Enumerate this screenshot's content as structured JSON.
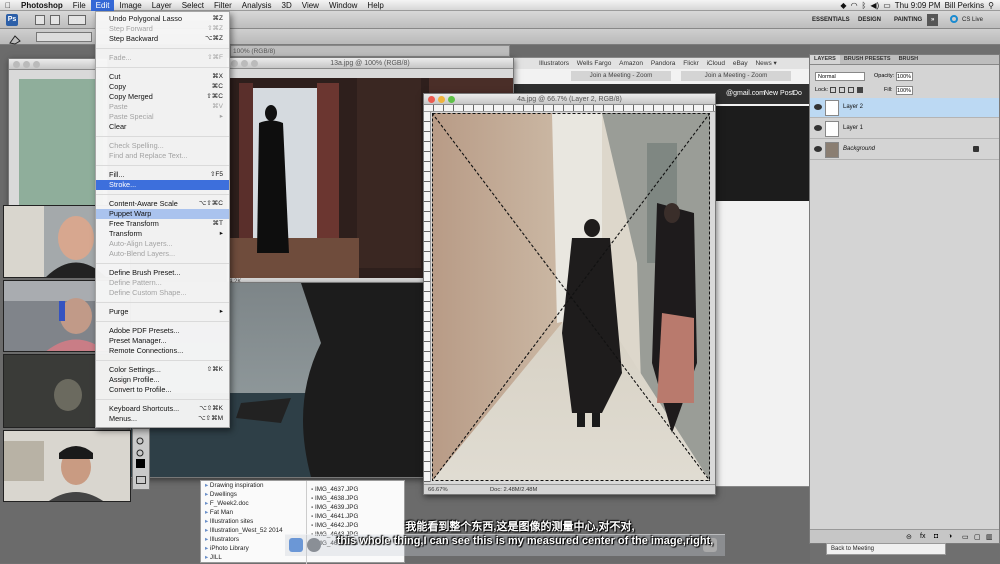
{
  "menubar": {
    "apple": "",
    "app": "Photoshop",
    "items": [
      "File",
      "Edit",
      "Image",
      "Layer",
      "Select",
      "Filter",
      "Analysis",
      "3D",
      "View",
      "Window",
      "Help"
    ],
    "clock": "Thu 9:09 PM",
    "user": "Bill Perkins"
  },
  "appbar": {
    "workspaces": [
      "ESSENTIALS",
      "DESIGN",
      "PAINTING"
    ],
    "more": "»",
    "cslive": "CS Live"
  },
  "edit_menu": {
    "items": [
      {
        "label": "Undo Polygonal Lasso",
        "shortcut": "⌘Z",
        "state": "normal"
      },
      {
        "label": "Step Forward",
        "shortcut": "⇧⌘Z",
        "state": "disabled"
      },
      {
        "label": "Step Backward",
        "shortcut": "⌥⌘Z",
        "state": "normal"
      },
      {
        "label": "Fade...",
        "shortcut": "⇧⌘F",
        "state": "disabled"
      },
      {
        "label": "Cut",
        "shortcut": "⌘X",
        "state": "normal"
      },
      {
        "label": "Copy",
        "shortcut": "⌘C",
        "state": "normal"
      },
      {
        "label": "Copy Merged",
        "shortcut": "⇧⌘C",
        "state": "normal"
      },
      {
        "label": "Paste",
        "shortcut": "⌘V",
        "state": "disabled"
      },
      {
        "label": "Paste Special",
        "shortcut": "▸",
        "state": "disabled"
      },
      {
        "label": "Clear",
        "shortcut": "",
        "state": "normal"
      },
      {
        "label": "Check Spelling...",
        "shortcut": "",
        "state": "disabled"
      },
      {
        "label": "Find and Replace Text...",
        "shortcut": "",
        "state": "disabled"
      },
      {
        "label": "Fill...",
        "shortcut": "⇧F5",
        "state": "normal"
      },
      {
        "label": "Stroke...",
        "shortcut": "",
        "state": "highlighted"
      },
      {
        "label": "Content-Aware Scale",
        "shortcut": "⌥⇧⌘C",
        "state": "normal"
      },
      {
        "label": "Puppet Warp",
        "shortcut": "",
        "state": "selected"
      },
      {
        "label": "Free Transform",
        "shortcut": "⌘T",
        "state": "normal"
      },
      {
        "label": "Transform",
        "shortcut": "▸",
        "state": "normal"
      },
      {
        "label": "Auto-Align Layers...",
        "shortcut": "",
        "state": "disabled"
      },
      {
        "label": "Auto-Blend Layers...",
        "shortcut": "",
        "state": "disabled"
      },
      {
        "label": "Define Brush Preset...",
        "shortcut": "",
        "state": "normal"
      },
      {
        "label": "Define Pattern...",
        "shortcut": "",
        "state": "disabled"
      },
      {
        "label": "Define Custom Shape...",
        "shortcut": "",
        "state": "disabled"
      },
      {
        "label": "Purge",
        "shortcut": "▸",
        "state": "normal"
      },
      {
        "label": "Adobe PDF Presets...",
        "shortcut": "",
        "state": "normal"
      },
      {
        "label": "Preset Manager...",
        "shortcut": "",
        "state": "normal"
      },
      {
        "label": "Remote Connections...",
        "shortcut": "",
        "state": "normal"
      },
      {
        "label": "Color Settings...",
        "shortcut": "⇧⌘K",
        "state": "normal"
      },
      {
        "label": "Assign Profile...",
        "shortcut": "",
        "state": "normal"
      },
      {
        "label": "Convert to Profile...",
        "shortcut": "",
        "state": "normal"
      },
      {
        "label": "Keyboard Shortcuts...",
        "shortcut": "⌥⇧⌘K",
        "state": "normal"
      },
      {
        "label": "Menus...",
        "shortcut": "⌥⇧⌘M",
        "state": "normal"
      }
    ]
  },
  "documents": {
    "back_title": "100% (RGB/8)",
    "doc13_title": "13a.jpg @ 100% (RGB/8)",
    "doc13_status": "4.2K",
    "doc4_title": "4a.jpg @ 66.7% (Layer 2, RGB/8)",
    "doc4_zoom": "66.67%",
    "doc4_status": "Doc: 2.48M/2.48M"
  },
  "browser": {
    "bookmarks": [
      "Illustrators",
      "Wells Fargo",
      "Amazon",
      "Pandora",
      "Flickr",
      "iCloud",
      "eBay",
      "News ▾"
    ],
    "tab1": "Join a Meeting - Zoom",
    "tab2": "Join a Meeting - Zoom",
    "email": "@gmail.com",
    "new_post": "New Post",
    "do": "Do"
  },
  "layers_panel": {
    "tabs": [
      "LAYERS",
      "BRUSH PRESETS",
      "BRUSH"
    ],
    "blend_mode": "Normal",
    "opacity_label": "Opacity:",
    "opacity_value": "100%",
    "lock_label": "Lock:",
    "fill_label": "Fill:",
    "fill_value": "100%",
    "layers": [
      {
        "name": "Layer 2",
        "selected": true
      },
      {
        "name": "Layer 1",
        "selected": false
      },
      {
        "name": "Background",
        "selected": false
      }
    ]
  },
  "finder": {
    "left_items": [
      "Drawing inspiration",
      "Dwellings",
      "F_Week2.doc",
      "Fat Man",
      "Illustration sites",
      "Illustration_West_52 2014",
      "Illustrators",
      "iPhoto Library",
      "JILL"
    ],
    "right_items": [
      "IMG_4637.JPG",
      "IMG_4638.JPG",
      "IMG_4639.JPG",
      "IMG_4641.JPG",
      "IMG_4642.JPG",
      "IMG_4643.JPG",
      "IMG_4645.JPG"
    ]
  },
  "zoom_bar": {
    "back_to_meeting": "Back to Meeting"
  },
  "subtitles": {
    "chinese": "我能看到整个东西,这是图像的测量中心,对不对,",
    "english": "this whole thing,I can see this is my measured center of the image,right,"
  },
  "colors": {
    "menu_highlight": "#3d6fdc",
    "layer_selected": "#bcd9f3"
  }
}
